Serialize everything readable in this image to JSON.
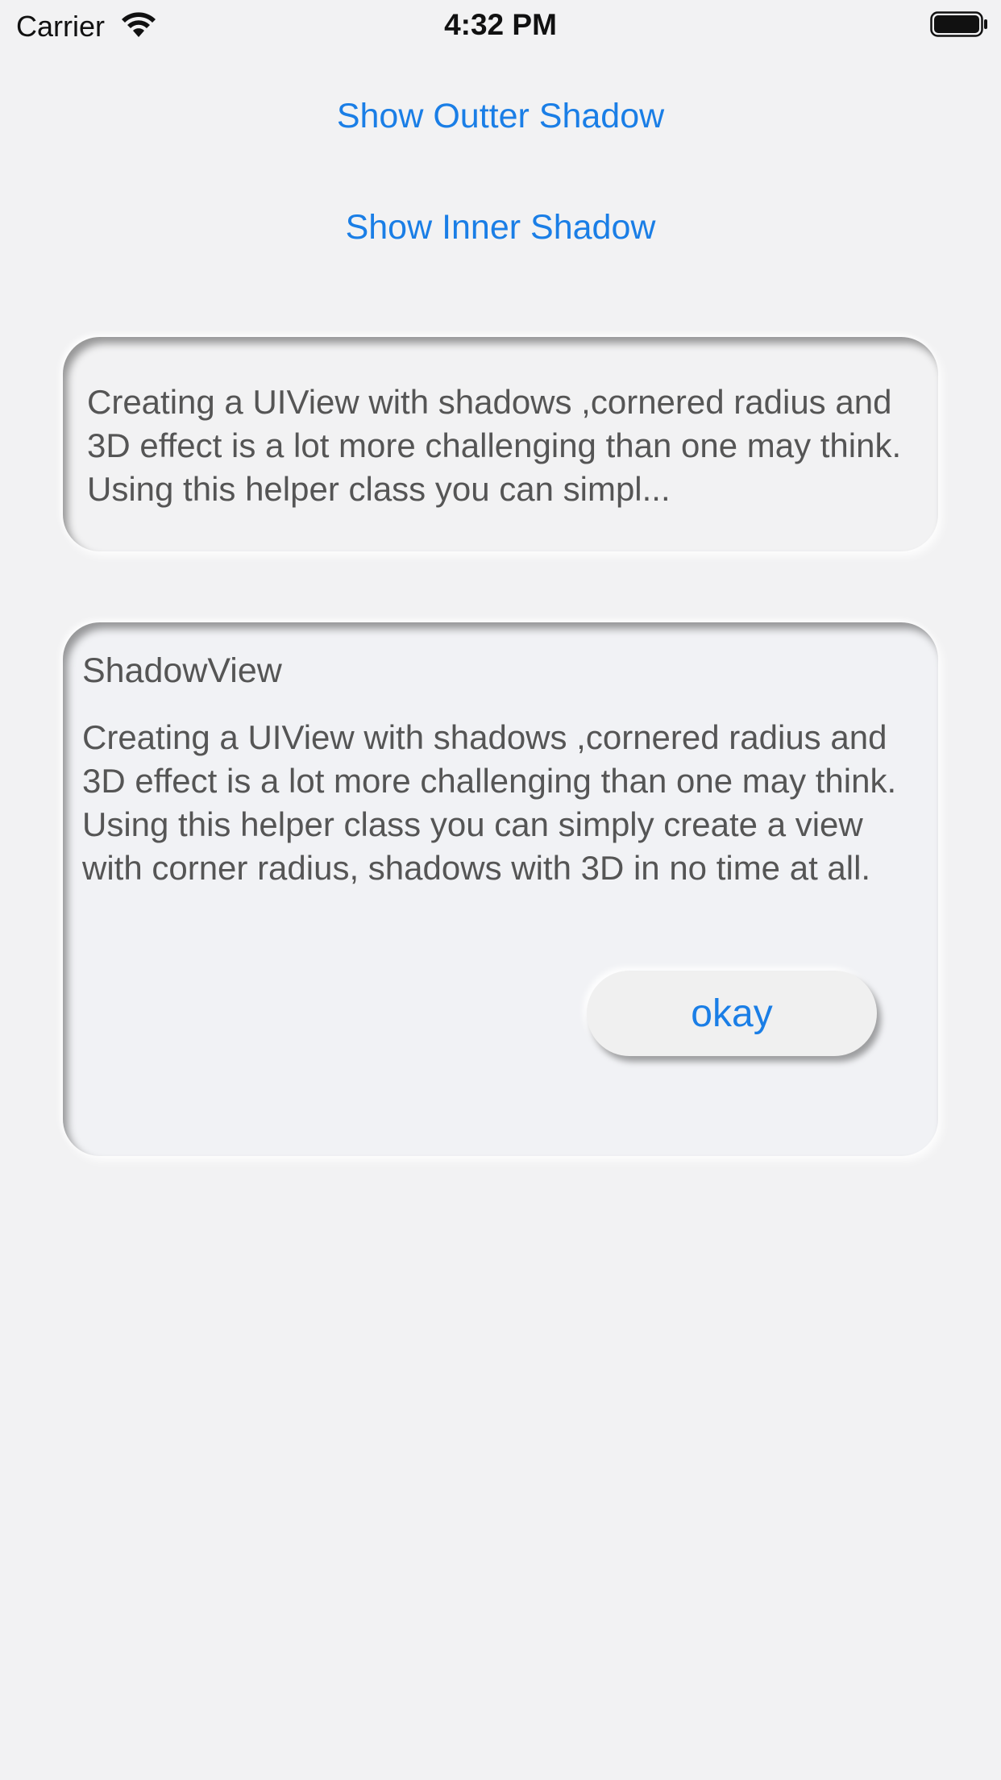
{
  "status_bar": {
    "carrier": "Carrier",
    "time": "4:32 PM",
    "icons": [
      "wifi-icon",
      "battery-icon"
    ]
  },
  "links": {
    "outer_shadow": "Show Outter Shadow",
    "inner_shadow": "Show Inner Shadow"
  },
  "card_preview": {
    "text": "Creating a UIView with shadows ,cornered radius and 3D effect is a lot more challenging than one may think. Using this helper class you can simpl..."
  },
  "card_detail": {
    "title": "ShadowView",
    "text": "Creating a UIView with shadows ,cornered radius and 3D effect is a lot more challenging than one may think. Using this helper class you can simply create a view with corner radius, shadows with 3D in no time at all.",
    "button_label": "okay"
  },
  "colors": {
    "accent": "#1a7ee6",
    "background": "#f2f2f3",
    "text": "#555555"
  }
}
